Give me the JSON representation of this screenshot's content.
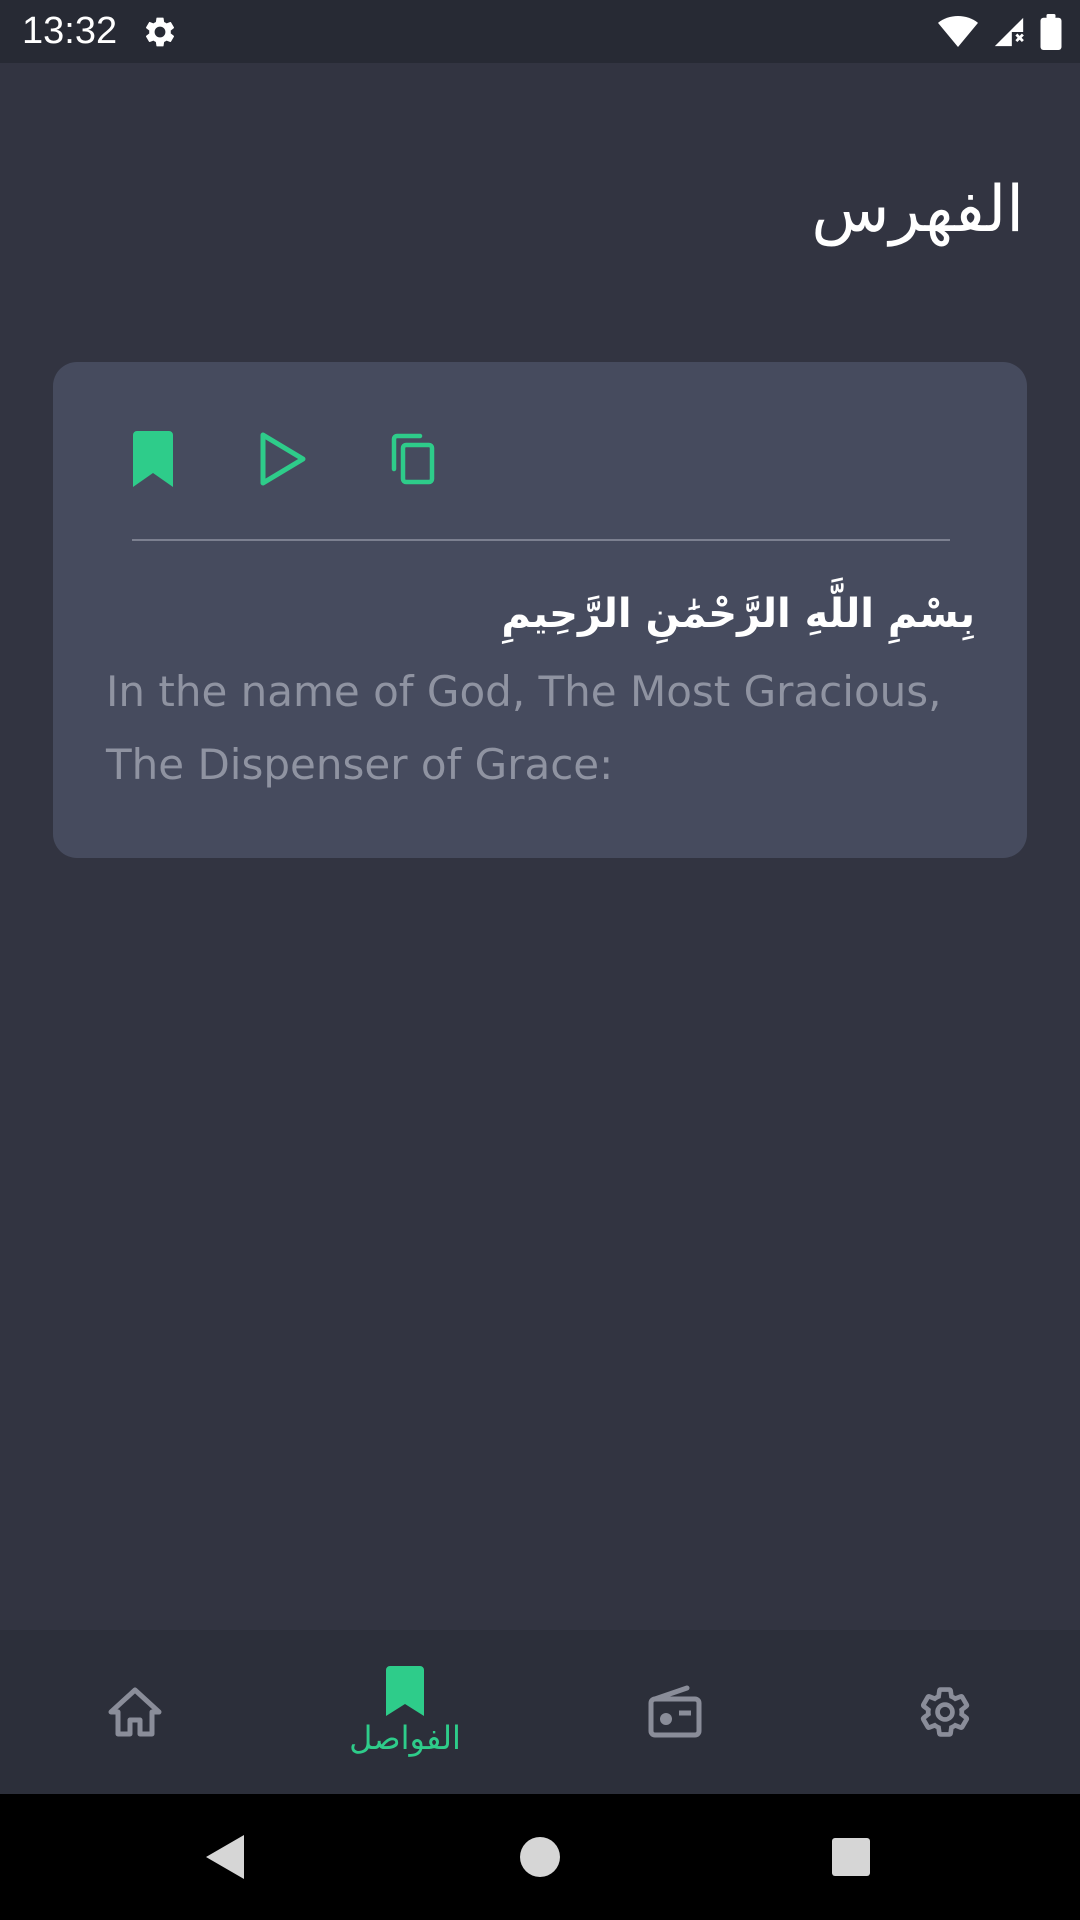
{
  "status_bar": {
    "time": "13:32",
    "icons": [
      "settings-icon",
      "wifi-icon",
      "signal-icon",
      "battery-icon"
    ]
  },
  "page": {
    "title": "الفهرس"
  },
  "card": {
    "actions": [
      "bookmark-icon",
      "play-icon",
      "copy-icon"
    ],
    "ayah_arabic": "بِسْمِ اللَّهِ الرَّحْمَٰنِ الرَّحِيمِ",
    "ayah_translation": "In the name of God, The Most Gracious, The Dispenser of Grace:"
  },
  "bottom_nav": {
    "items": [
      {
        "icon": "home-icon",
        "label": "",
        "active": false
      },
      {
        "icon": "bookmark-icon",
        "label": "الفواصل",
        "active": true
      },
      {
        "icon": "radio-icon",
        "label": "",
        "active": false
      },
      {
        "icon": "settings-icon",
        "label": "",
        "active": false
      }
    ]
  },
  "system_nav": {
    "buttons": [
      "back-icon",
      "home-circle-icon",
      "recents-icon"
    ]
  },
  "colors": {
    "background": "#323441",
    "card": "#464b5e",
    "accent": "#2ecc8a",
    "inactive_icon": "#8a8d99",
    "translation_text": "#8f93a1"
  }
}
